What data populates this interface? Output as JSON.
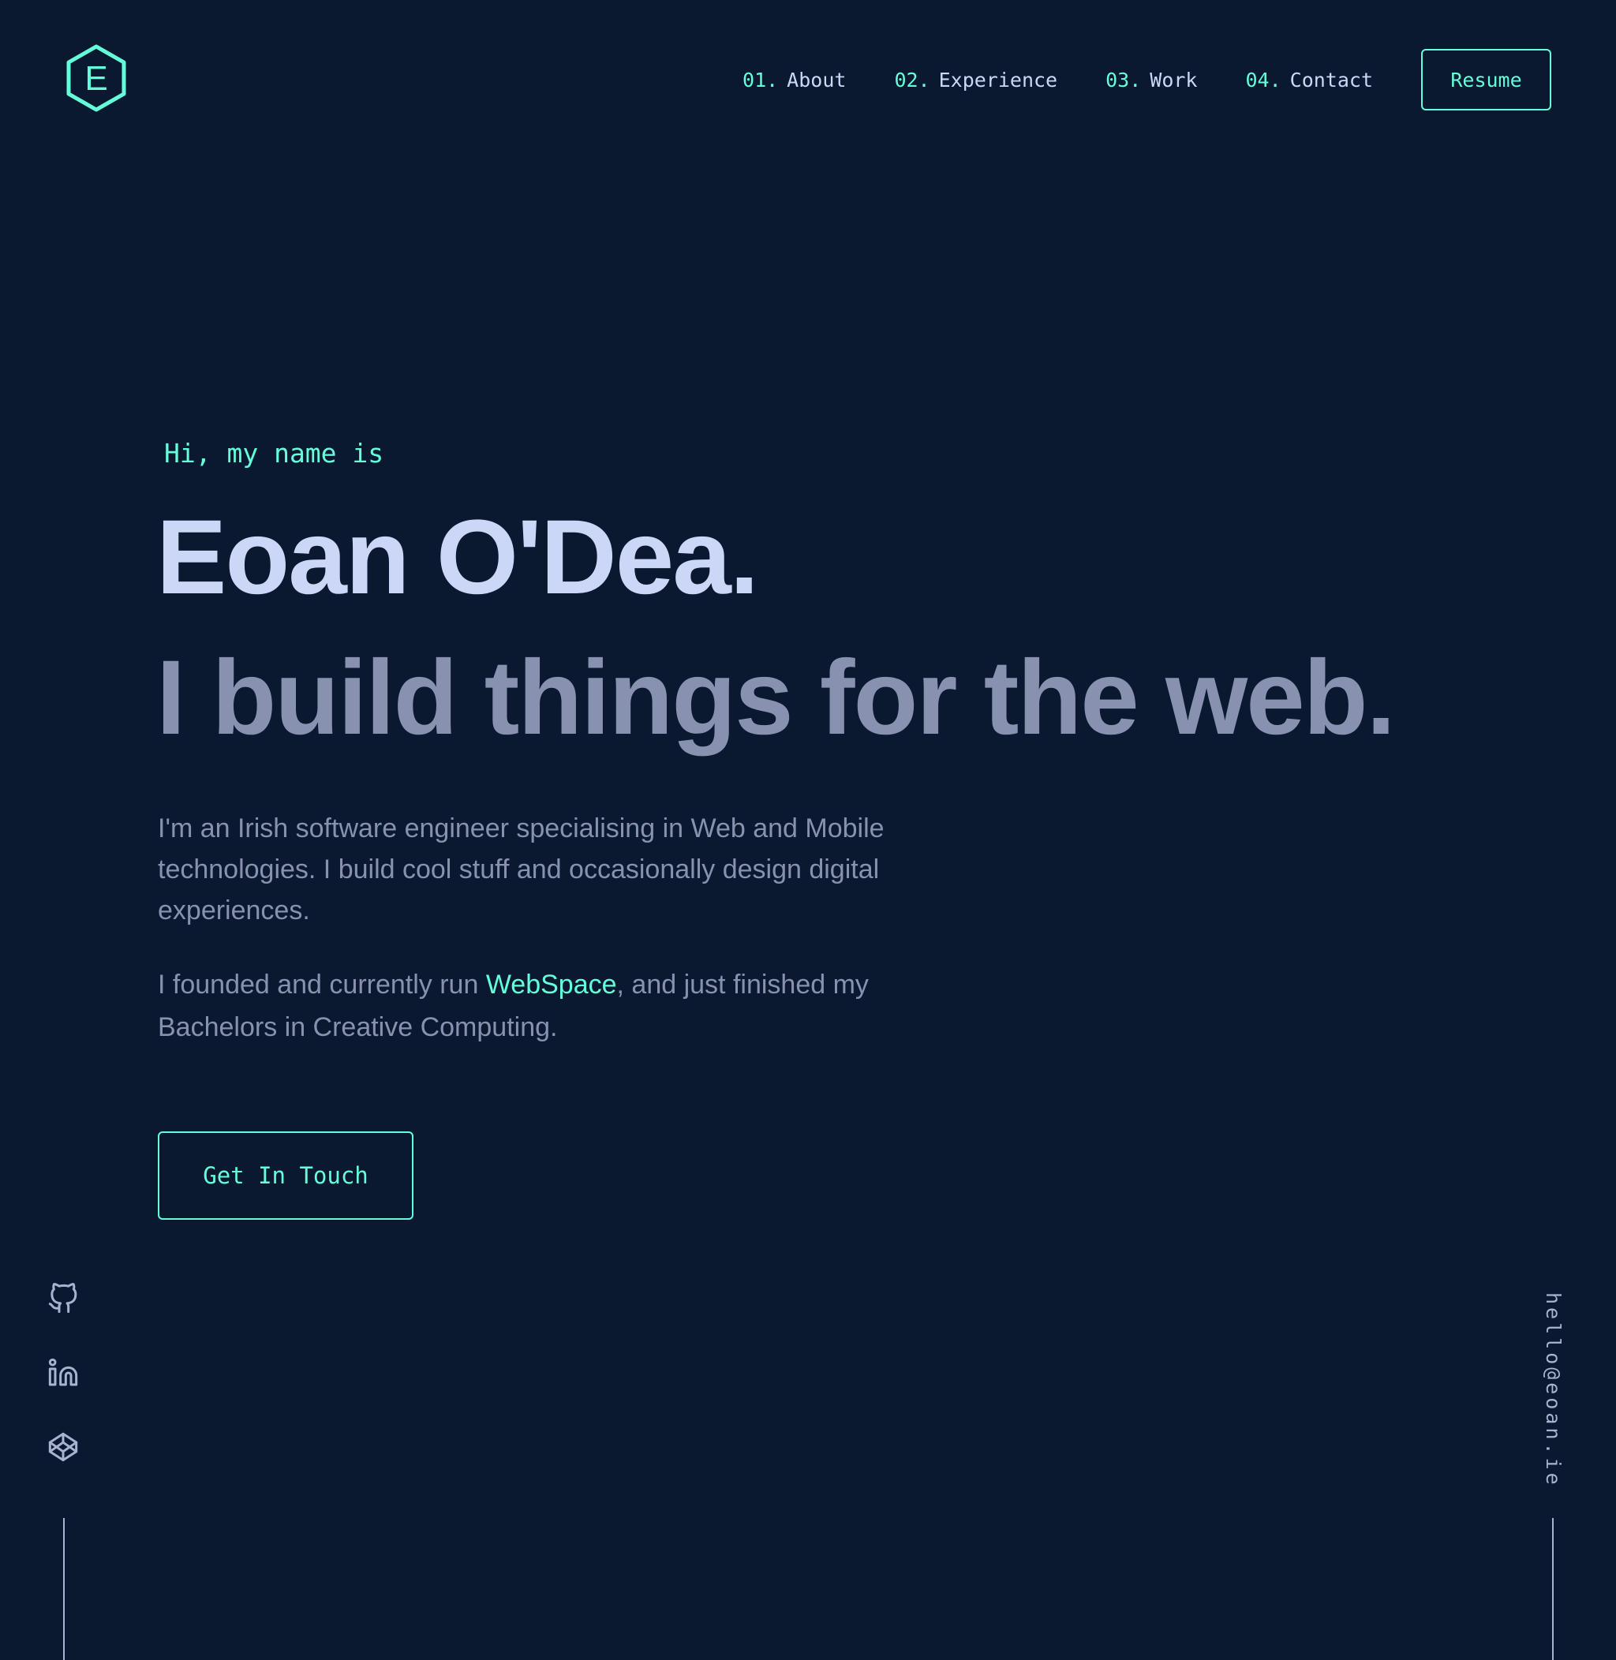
{
  "colors": {
    "background": "#0a192f",
    "accent": "#64ffda",
    "heading": "#ccd6f6",
    "text": "#8892b0",
    "rail": "#a8b2d1"
  },
  "logo": {
    "letter": "E",
    "icon": "hexagon-logo-icon"
  },
  "nav": {
    "items": [
      {
        "num": "01.",
        "label": "About"
      },
      {
        "num": "02.",
        "label": "Experience"
      },
      {
        "num": "03.",
        "label": "Work"
      },
      {
        "num": "04.",
        "label": "Contact"
      }
    ],
    "resume_label": "Resume"
  },
  "hero": {
    "intro": "Hi, my name is",
    "name": "Eoan O'Dea.",
    "tagline": "I build things for the web.",
    "description": "I'm an Irish software engineer specialising in Web and Mobile technologies. I build cool stuff and occasionally design digital experiences.",
    "description2_before": "I founded and currently run ",
    "description2_link": "WebSpace",
    "description2_after": ", and just finished my Bachelors in Creative Computing.",
    "cta_label": "Get In Touch"
  },
  "social": {
    "icons": [
      "github-icon",
      "linkedin-icon",
      "codepen-icon"
    ]
  },
  "email": "hello@eoan.ie"
}
